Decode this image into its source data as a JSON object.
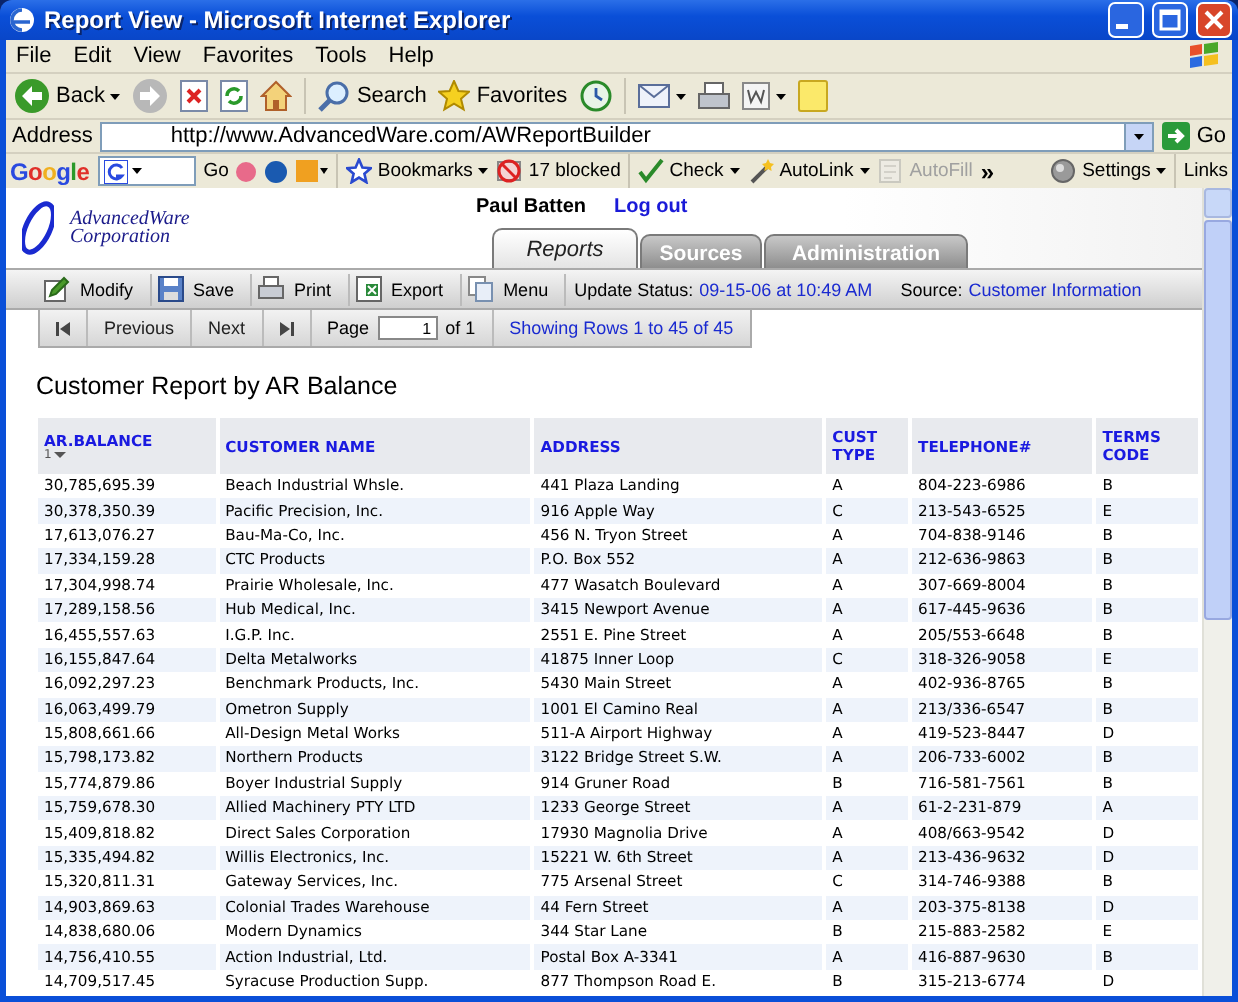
{
  "window": {
    "title": "Report View - Microsoft Internet Explorer"
  },
  "menu_bar": [
    "File",
    "Edit",
    "View",
    "Favorites",
    "Tools",
    "Help"
  ],
  "browser_toolbar": [
    {
      "kind": "back",
      "label": "Back"
    },
    {
      "kind": "forward"
    },
    {
      "kind": "stop"
    },
    {
      "kind": "refresh"
    },
    {
      "kind": "home"
    },
    {
      "kind": "search",
      "label": "Search"
    },
    {
      "kind": "favorites",
      "label": "Favorites"
    },
    {
      "kind": "history"
    },
    {
      "kind": "mail"
    },
    {
      "kind": "print"
    },
    {
      "kind": "edit"
    },
    {
      "kind": "note"
    }
  ],
  "address_bar": {
    "label": "Address",
    "value": "http://www.AdvancedWare.com/AWReportBuilder",
    "go": "Go"
  },
  "google_bar": {
    "logo": "Google",
    "go": "Go",
    "more": "»",
    "links": "Links",
    "items": [
      {
        "kind": "bookmarks",
        "label": "Bookmarks",
        "disabled": false
      },
      {
        "kind": "blocked",
        "label": "17 blocked",
        "disabled": false
      },
      {
        "kind": "check",
        "label": "Check",
        "disabled": false
      },
      {
        "kind": "autolink",
        "label": "AutoLink",
        "disabled": false
      },
      {
        "kind": "autofill",
        "label": "AutoFill",
        "disabled": true
      },
      {
        "kind": "settings",
        "label": "Settings",
        "disabled": false
      }
    ]
  },
  "app": {
    "logo": [
      "AdvancedWare",
      "Corporation"
    ],
    "user": "Paul Batten",
    "logout": "Log out",
    "tabs": [
      {
        "label": "Reports",
        "selected": true
      },
      {
        "label": "Sources",
        "selected": false
      },
      {
        "label": "Administration",
        "selected": false
      }
    ],
    "toolbar": [
      {
        "kind": "modify",
        "label": "Modify"
      },
      {
        "kind": "save",
        "label": "Save"
      },
      {
        "kind": "print",
        "label": "Print"
      },
      {
        "kind": "export",
        "label": "Export"
      },
      {
        "kind": "menu",
        "label": "Menu"
      }
    ],
    "update_status": {
      "label": "Update Status:",
      "value": "09-15-06 at 10:49 AM"
    },
    "source": {
      "label": "Source:",
      "value": "Customer Information"
    },
    "pager": {
      "previous": "Previous",
      "next": "Next",
      "page_label": "Page",
      "page": "1",
      "of": "of 1",
      "showing": "Showing Rows 1 to 45 of 45"
    }
  },
  "report": {
    "title": "Customer Report by AR Balance",
    "columns": [
      {
        "label": "AR.BALANCE",
        "sort": {
          "rank": "1",
          "descending": true
        }
      },
      {
        "label": "CUSTOMER NAME"
      },
      {
        "label": "ADDRESS"
      },
      {
        "label": "CUST TYPE"
      },
      {
        "label": "TELEPHONE#"
      },
      {
        "label": "TERMS CODE"
      }
    ],
    "rows": [
      [
        "30,785,695.39",
        "Beach Industrial Whsle.",
        "441 Plaza Landing",
        "A",
        "804-223-6986",
        "B"
      ],
      [
        "30,378,350.39",
        "Pacific Precision, Inc.",
        "916 Apple Way",
        "C",
        "213-543-6525",
        "E"
      ],
      [
        "17,613,076.27",
        "Bau-Ma-Co, Inc.",
        "456 N. Tryon Street",
        "A",
        "704-838-9146",
        "B"
      ],
      [
        "17,334,159.28",
        "CTC Products",
        "P.O. Box 552",
        "A",
        "212-636-9863",
        "B"
      ],
      [
        "17,304,998.74",
        "Prairie Wholesale, Inc.",
        "477 Wasatch Boulevard",
        "A",
        "307-669-8004",
        "B"
      ],
      [
        "17,289,158.56",
        "Hub Medical, Inc.",
        "3415 Newport Avenue",
        "A",
        "617-445-9636",
        "B"
      ],
      [
        "16,455,557.63",
        "I.G.P. Inc.",
        "2551 E. Pine Street",
        "A",
        "205/553-6648",
        "B"
      ],
      [
        "16,155,847.64",
        "Delta Metalworks",
        "41875 Inner Loop",
        "C",
        "318-326-9058",
        "E"
      ],
      [
        "16,092,297.23",
        "Benchmark Products, Inc.",
        "5430 Main Street",
        "A",
        "402-936-8765",
        "B"
      ],
      [
        "16,063,499.79",
        "Ometron Supply",
        "1001 El Camino Real",
        "A",
        "213/336-6547",
        "B"
      ],
      [
        "15,808,661.66",
        "All-Design Metal Works",
        "511-A Airport Highway",
        "A",
        "419-523-8447",
        "D"
      ],
      [
        "15,798,173.82",
        "Northern Products",
        "3122 Bridge Street S.W.",
        "A",
        "206-733-6002",
        "B"
      ],
      [
        "15,774,879.86",
        "Boyer Industrial Supply",
        "914 Gruner Road",
        "B",
        "716-581-7561",
        "B"
      ],
      [
        "15,759,678.30",
        "Allied Machinery PTY LTD",
        "1233 George Street",
        "A",
        "61-2-231-879",
        "A"
      ],
      [
        "15,409,818.82",
        "Direct Sales Corporation",
        "17930 Magnolia Drive",
        "A",
        "408/663-9542",
        "D"
      ],
      [
        "15,335,494.82",
        "Willis Electronics, Inc.",
        "15221 W. 6th Street",
        "A",
        "213-436-9632",
        "D"
      ],
      [
        "15,320,811.31",
        "Gateway Services, Inc.",
        "775 Arsenal Street",
        "C",
        "314-746-9388",
        "B"
      ],
      [
        "14,903,869.63",
        "Colonial Trades Warehouse",
        "44 Fern Street",
        "A",
        "203-375-8138",
        "D"
      ],
      [
        "14,838,680.06",
        "Modern Dynamics",
        "344 Star Lane",
        "B",
        "215-883-2582",
        "E"
      ],
      [
        "14,756,410.55",
        "Action Industrial, Ltd.",
        "Postal Box A-3341",
        "A",
        "416-887-9630",
        "B"
      ],
      [
        "14,709,517.45",
        "Syracuse Production Supp.",
        "877 Thompson Road E.",
        "B",
        "315-213-6774",
        "D"
      ]
    ]
  }
}
